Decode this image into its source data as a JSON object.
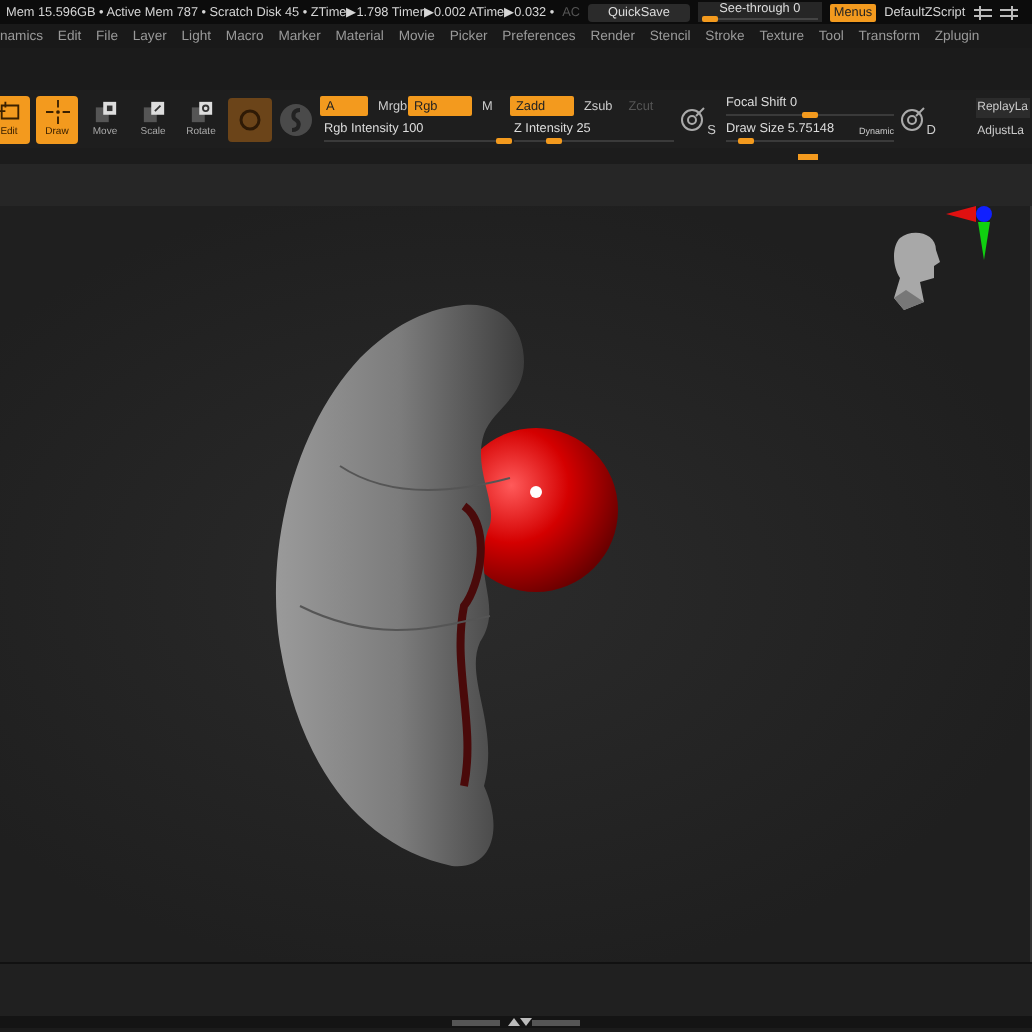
{
  "status_bar": {
    "text": "Mem 15.596GB • Active Mem 787 • Scratch Disk 45 • ZTime▶1.798 Timer▶0.002 ATime▶0.032 •",
    "ac": {
      "label": "AC",
      "disabled": true
    },
    "quicksave": "QuickSave",
    "see_through": {
      "label": "See-through  0",
      "level": 0
    },
    "menus": {
      "label": "Menus",
      "on": true
    },
    "script": "DefaultZScript"
  },
  "menu_bar": [
    "namics",
    "Edit",
    "File",
    "Layer",
    "Light",
    "Macro",
    "Marker",
    "Material",
    "Movie",
    "Picker",
    "Preferences",
    "Render",
    "Stencil",
    "Stroke",
    "Texture",
    "Tool",
    "Transform",
    "Zplugin"
  ],
  "tools": [
    {
      "label": "Edit",
      "kind": "edit",
      "selected": true
    },
    {
      "label": "Draw",
      "kind": "draw",
      "selected": true
    },
    {
      "label": "Move",
      "kind": "move",
      "selected": false
    },
    {
      "label": "Scale",
      "kind": "scale",
      "selected": false
    },
    {
      "label": "Rotate",
      "kind": "rotate",
      "selected": false
    }
  ],
  "channels": {
    "buttons": [
      {
        "label": "A",
        "selected": true
      },
      {
        "label": "Mrgb",
        "selected": false
      },
      {
        "label": "Rgb",
        "selected": true
      },
      {
        "label": "M",
        "selected": false
      }
    ],
    "slider": {
      "label": "Rgb Intensity 100",
      "level": 1
    }
  },
  "sculpt_modes": {
    "buttons": [
      {
        "label": "Zadd",
        "selected": true,
        "disabled": false
      },
      {
        "label": "Zsub",
        "selected": false,
        "disabled": false
      },
      {
        "label": "Zcut",
        "selected": false,
        "disabled": true
      }
    ],
    "slider": {
      "label": "Z Intensity 25",
      "level": 0.25
    }
  },
  "stroke_letter": "S",
  "brush_sliders": [
    {
      "label": "Focal Shift 0",
      "level": 0.5
    },
    {
      "label": "Draw Size 5.75148",
      "level": 0.12,
      "badge": "Dynamic"
    }
  ],
  "draw_letter": "D",
  "side_buttons": [
    "ReplayLa",
    "AdjustLa"
  ]
}
